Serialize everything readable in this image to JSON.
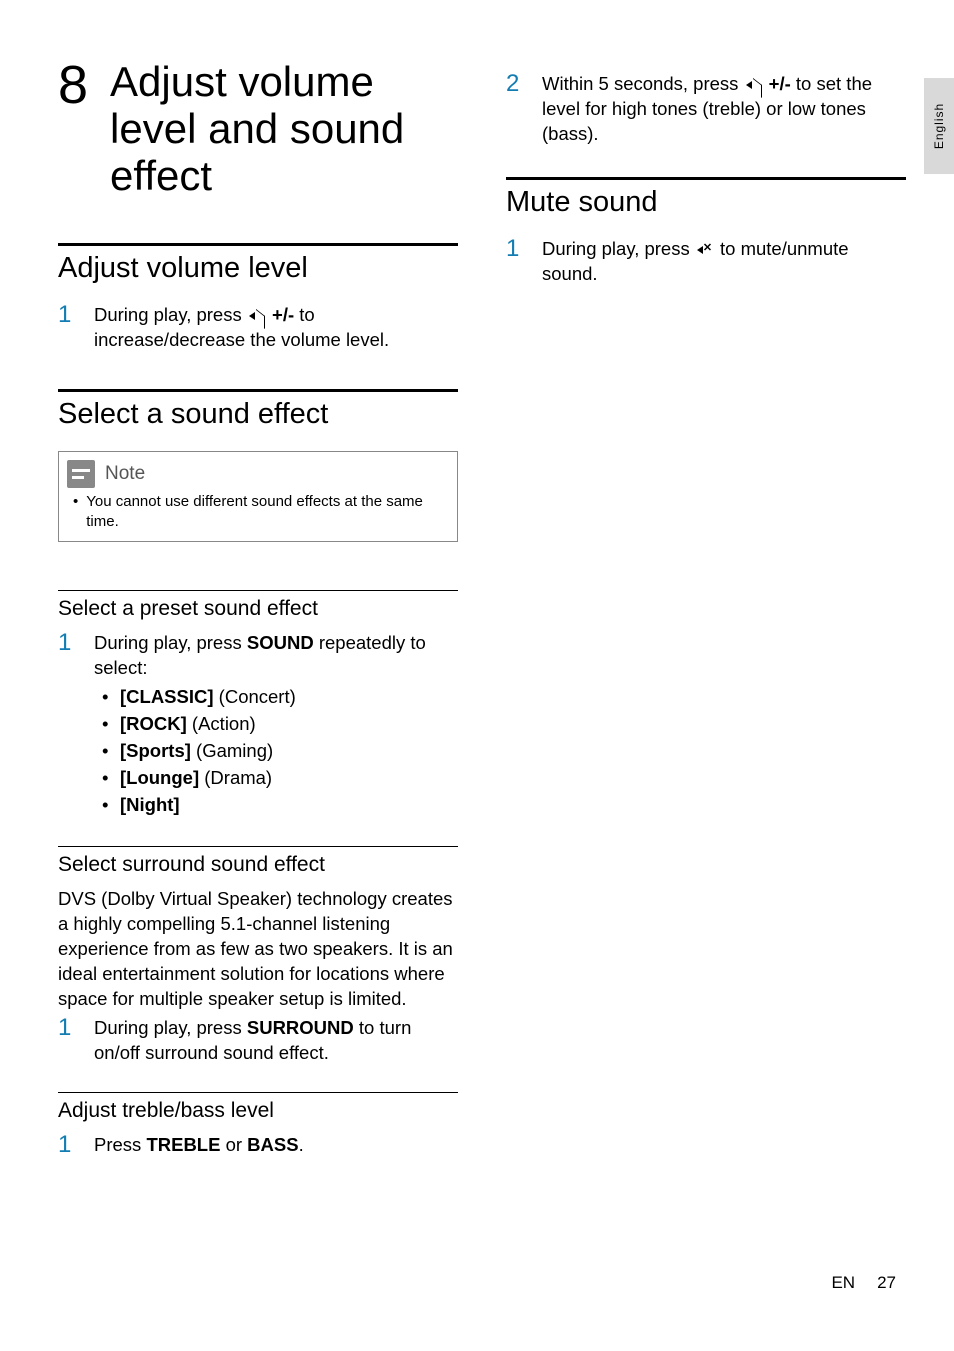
{
  "sideTab": "English",
  "chapter": {
    "num": "8",
    "title": "Adjust volume level and sound effect"
  },
  "left": {
    "s1": {
      "heading": "Adjust volume level",
      "step1_num": "1",
      "step1_a": "During play, press ",
      "step1_b": " +/-",
      "step1_c": " to increase/decrease the volume level."
    },
    "s2": {
      "heading": "Select a sound effect",
      "note_label": "Note",
      "note_text": "You cannot use different sound effects at the same time."
    },
    "s3": {
      "heading": "Select a preset sound effect",
      "step1_num": "1",
      "step1_a": "During play, press ",
      "step1_b": "SOUND",
      "step1_c": " repeatedly to select:",
      "opts": [
        {
          "b": "[CLASSIC]",
          "r": " (Concert)"
        },
        {
          "b": "[ROCK]",
          "r": " (Action)"
        },
        {
          "b": "[Sports]",
          "r": " (Gaming)"
        },
        {
          "b": "[Lounge]",
          "r": " (Drama)"
        },
        {
          "b": "[Night]",
          "r": ""
        }
      ]
    },
    "s4": {
      "heading": "Select surround sound effect",
      "para": "DVS (Dolby Virtual Speaker) technology creates a highly compelling 5.1-channel listening experience from as few as two speakers. It is an ideal entertainment solution for locations where space for multiple speaker setup is limited.",
      "step1_num": "1",
      "step1_a": "During play, press ",
      "step1_b": "SURROUND",
      "step1_c": " to turn on/off surround sound effect."
    },
    "s5": {
      "heading": "Adjust treble/bass level",
      "step1_num": "1",
      "step1_a": "Press ",
      "step1_b": "TREBLE",
      "step1_c": " or ",
      "step1_d": "BASS",
      "step1_e": "."
    }
  },
  "right": {
    "cont": {
      "step2_num": "2",
      "step2_a": "Within 5 seconds, press ",
      "step2_b": " +/-",
      "step2_c": " to set the level for high tones (treble) or low tones (bass)."
    },
    "mute": {
      "heading": "Mute sound",
      "step1_num": "1",
      "step1_a": "During play, press ",
      "step1_c": " to mute/unmute sound."
    }
  },
  "footer": {
    "lang": "EN",
    "page": "27"
  }
}
